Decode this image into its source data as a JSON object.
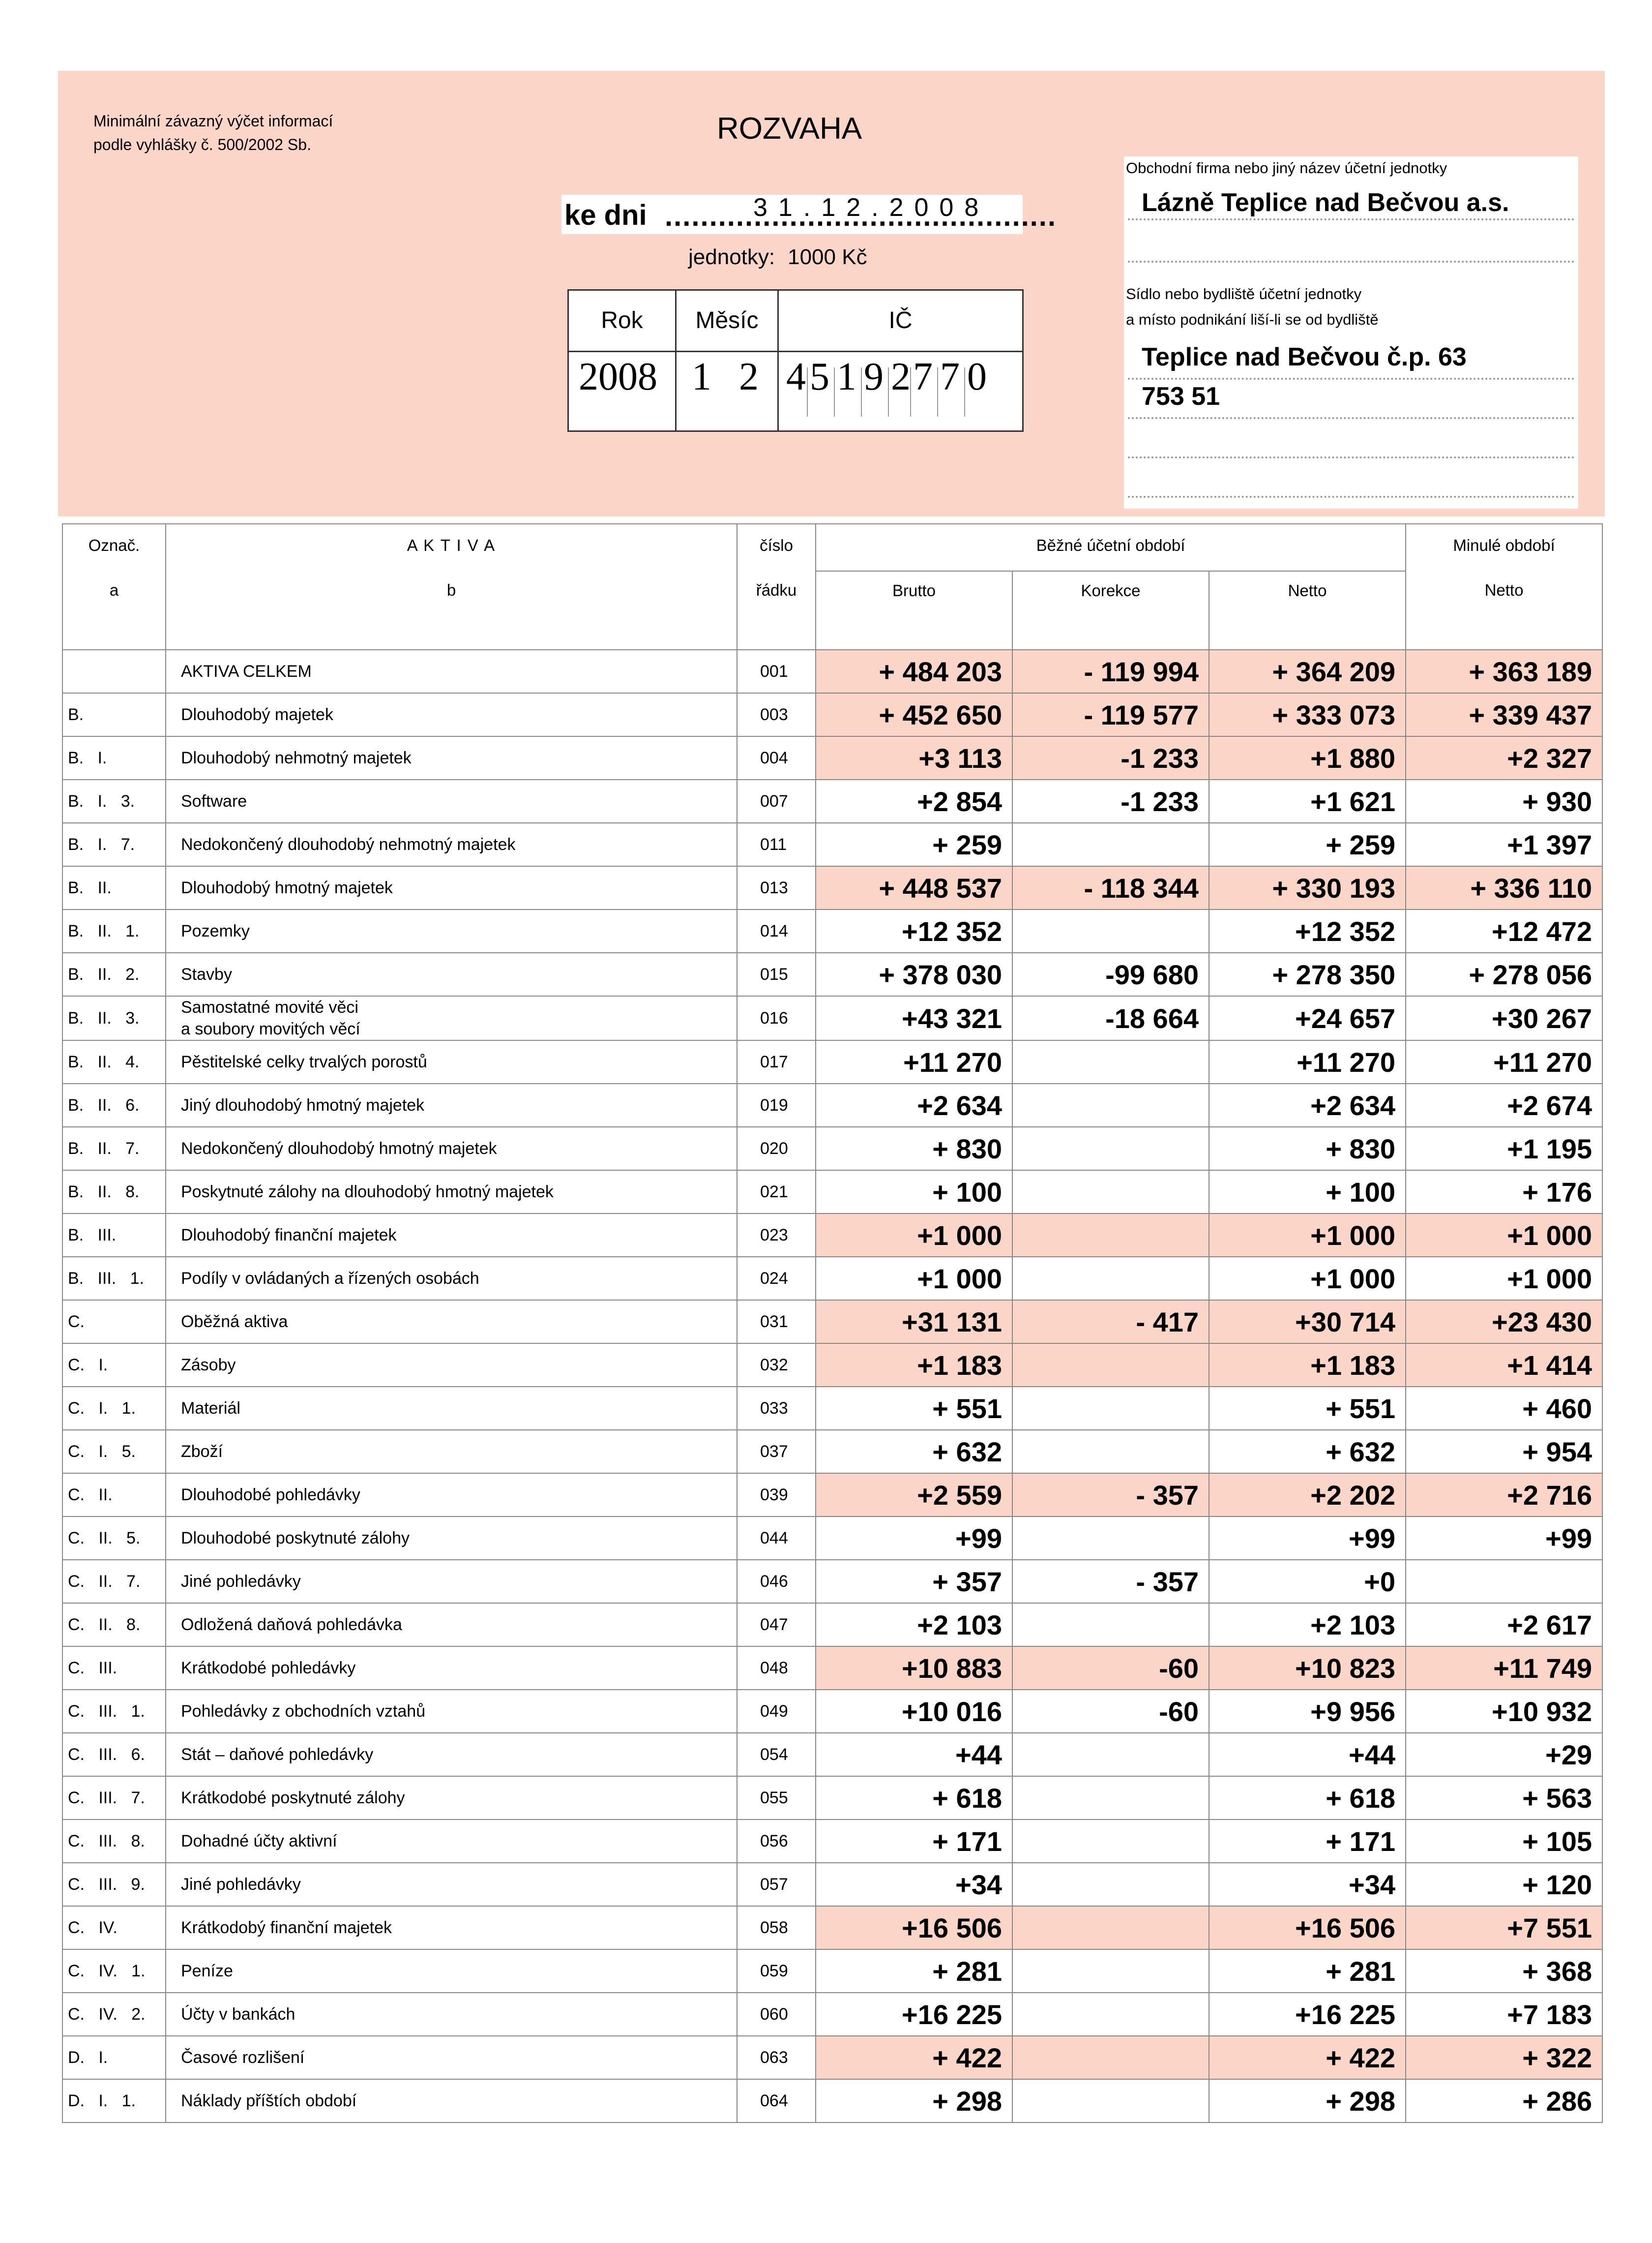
{
  "header": {
    "note_line1": "Minimální závazný výčet informací",
    "note_line2": "podle vyhlášky č. 500/2002 Sb.",
    "title": "ROZVAHA",
    "ke_dni_label": "ke dni",
    "date": "31.12.2008",
    "units_label": "jednotky:",
    "units_value": "1000 Kč",
    "col_rok": "Rok",
    "col_mesic": "Měsíc",
    "col_ic": "IČ",
    "rok": "2008",
    "mesic_digits": [
      "1",
      "2"
    ],
    "ic_digits": [
      "4",
      "5",
      "1",
      "9",
      "2",
      "7",
      "7",
      "0"
    ]
  },
  "firm": {
    "name_label": "Obchodní firma nebo jiný název účetní jednotky",
    "name": "Lázně Teplice nad Bečvou a.s.",
    "seat_label1": "Sídlo nebo bydliště účetní jednotky",
    "seat_label2": "a místo podnikání liší-li se od bydliště",
    "address1": "Teplice nad Bečvou č.p. 63",
    "address2": "753 51"
  },
  "table": {
    "h_oznac": "Označ.",
    "h_oznac_sub": "a",
    "h_aktiva": "A K T I V A",
    "h_aktiva_sub": "b",
    "h_cislo": "číslo",
    "h_radku": "řádku",
    "h_bezne": "Běžné účetní období",
    "h_minule": "Minulé období",
    "h_brutto": "Brutto",
    "h_korekce": "Korekce",
    "h_netto": "Netto",
    "h_netto_prev": "Netto",
    "rows": [
      {
        "mark": "",
        "name": "AKTIVA CELKEM",
        "code": "001",
        "brutto": "+ 484 203",
        "korekce": "- 119 994",
        "netto": "+ 364 209",
        "prev": "+ 363 189",
        "hl": true
      },
      {
        "mark": "B.",
        "name": "Dlouhodobý majetek",
        "code": "003",
        "brutto": "+ 452 650",
        "korekce": "- 119 577",
        "netto": "+ 333 073",
        "prev": "+ 339 437",
        "hl": true
      },
      {
        "mark": "B.   I.",
        "name": "Dlouhodobý nehmotný majetek",
        "code": "004",
        "brutto": "+3 113",
        "korekce": "-1 233",
        "netto": "+1 880",
        "prev": "+2 327",
        "hl": true
      },
      {
        "mark": "B.   I.   3.",
        "name": "Software",
        "code": "007",
        "brutto": "+2 854",
        "korekce": "-1 233",
        "netto": "+1 621",
        "prev": "+ 930",
        "hl": false
      },
      {
        "mark": "B.   I.   7.",
        "name": "Nedokončený dlouhodobý nehmotný majetek",
        "code": "011",
        "brutto": "+ 259",
        "korekce": "",
        "netto": "+ 259",
        "prev": "+1 397",
        "hl": false
      },
      {
        "mark": "B.   II.",
        "name": "Dlouhodobý hmotný majetek",
        "code": "013",
        "brutto": "+ 448 537",
        "korekce": "- 118 344",
        "netto": "+ 330 193",
        "prev": "+ 336 110",
        "hl": true
      },
      {
        "mark": "B.   II.   1.",
        "name": "Pozemky",
        "code": "014",
        "brutto": "+12 352",
        "korekce": "",
        "netto": "+12 352",
        "prev": "+12 472",
        "hl": false
      },
      {
        "mark": "B.   II.   2.",
        "name": "Stavby",
        "code": "015",
        "brutto": "+ 378 030",
        "korekce": "-99 680",
        "netto": "+ 278 350",
        "prev": "+ 278 056",
        "hl": false
      },
      {
        "mark": "B.   II.   3.",
        "name": "Samostatné movité věci\na soubory movitých věcí",
        "code": "016",
        "brutto": "+43 321",
        "korekce": "-18 664",
        "netto": "+24 657",
        "prev": "+30 267",
        "hl": false
      },
      {
        "mark": "B.   II.   4.",
        "name": "Pěstitelské celky trvalých porostů",
        "code": "017",
        "brutto": "+11 270",
        "korekce": "",
        "netto": "+11 270",
        "prev": "+11 270",
        "hl": false
      },
      {
        "mark": "B.   II.   6.",
        "name": "Jiný dlouhodobý hmotný majetek",
        "code": "019",
        "brutto": "+2 634",
        "korekce": "",
        "netto": "+2 634",
        "prev": "+2 674",
        "hl": false
      },
      {
        "mark": "B.   II.   7.",
        "name": "Nedokončený dlouhodobý hmotný majetek",
        "code": "020",
        "brutto": "+ 830",
        "korekce": "",
        "netto": "+ 830",
        "prev": "+1 195",
        "hl": false
      },
      {
        "mark": "B.   II.   8.",
        "name": "Poskytnuté zálohy na dlouhodobý hmotný majetek",
        "code": "021",
        "brutto": "+ 100",
        "korekce": "",
        "netto": "+ 100",
        "prev": "+ 176",
        "hl": false
      },
      {
        "mark": "B.   III.",
        "name": "Dlouhodobý finanční majetek",
        "code": "023",
        "brutto": "+1 000",
        "korekce": "",
        "netto": "+1 000",
        "prev": "+1 000",
        "hl": true
      },
      {
        "mark": "B.   III.   1.",
        "name": "Podíly v ovládaných a řízených osobách",
        "code": "024",
        "brutto": "+1 000",
        "korekce": "",
        "netto": "+1 000",
        "prev": "+1 000",
        "hl": false
      },
      {
        "mark": "C.",
        "name": "Oběžná aktiva",
        "code": "031",
        "brutto": "+31 131",
        "korekce": "- 417",
        "netto": "+30 714",
        "prev": "+23 430",
        "hl": true
      },
      {
        "mark": "C.   I.",
        "name": "Zásoby",
        "code": "032",
        "brutto": "+1 183",
        "korekce": "",
        "netto": "+1 183",
        "prev": "+1 414",
        "hl": true
      },
      {
        "mark": "C.   I.   1.",
        "name": "Materiál",
        "code": "033",
        "brutto": "+ 551",
        "korekce": "",
        "netto": "+ 551",
        "prev": "+ 460",
        "hl": false
      },
      {
        "mark": "C.   I.   5.",
        "name": "Zboží",
        "code": "037",
        "brutto": "+ 632",
        "korekce": "",
        "netto": "+ 632",
        "prev": "+ 954",
        "hl": false
      },
      {
        "mark": "C.   II.",
        "name": "Dlouhodobé pohledávky",
        "code": "039",
        "brutto": "+2 559",
        "korekce": "- 357",
        "netto": "+2 202",
        "prev": "+2 716",
        "hl": true
      },
      {
        "mark": "C.   II.   5.",
        "name": "Dlouhodobé poskytnuté zálohy",
        "code": "044",
        "brutto": "+99",
        "korekce": "",
        "netto": "+99",
        "prev": "+99",
        "hl": false
      },
      {
        "mark": "C.   II.   7.",
        "name": "Jiné pohledávky",
        "code": "046",
        "brutto": "+ 357",
        "korekce": "- 357",
        "netto": "+0",
        "prev": "",
        "hl": false
      },
      {
        "mark": "C.   II.   8.",
        "name": "Odložená daňová pohledávka",
        "code": "047",
        "brutto": "+2 103",
        "korekce": "",
        "netto": "+2 103",
        "prev": "+2 617",
        "hl": false
      },
      {
        "mark": "C.   III.",
        "name": "Krátkodobé pohledávky",
        "code": "048",
        "brutto": "+10 883",
        "korekce": "-60",
        "netto": "+10 823",
        "prev": "+11 749",
        "hl": true
      },
      {
        "mark": "C.   III.   1.",
        "name": "Pohledávky z obchodních vztahů",
        "code": "049",
        "brutto": "+10 016",
        "korekce": "-60",
        "netto": "+9 956",
        "prev": "+10 932",
        "hl": false
      },
      {
        "mark": "C.   III.   6.",
        "name": "Stát – daňové pohledávky",
        "code": "054",
        "brutto": "+44",
        "korekce": "",
        "netto": "+44",
        "prev": "+29",
        "hl": false
      },
      {
        "mark": "C.   III.   7.",
        "name": "Krátkodobé poskytnuté zálohy",
        "code": "055",
        "brutto": "+ 618",
        "korekce": "",
        "netto": "+ 618",
        "prev": "+ 563",
        "hl": false
      },
      {
        "mark": "C.   III.   8.",
        "name": "Dohadné účty aktivní",
        "code": "056",
        "brutto": "+ 171",
        "korekce": "",
        "netto": "+ 171",
        "prev": "+ 105",
        "hl": false
      },
      {
        "mark": "C.   III.   9.",
        "name": "Jiné pohledávky",
        "code": "057",
        "brutto": "+34",
        "korekce": "",
        "netto": "+34",
        "prev": "+ 120",
        "hl": false
      },
      {
        "mark": "C.   IV.",
        "name": "Krátkodobý finanční majetek",
        "code": "058",
        "brutto": "+16 506",
        "korekce": "",
        "netto": "+16 506",
        "prev": "+7 551",
        "hl": true
      },
      {
        "mark": "C.   IV.   1.",
        "name": "Peníze",
        "code": "059",
        "brutto": "+ 281",
        "korekce": "",
        "netto": "+ 281",
        "prev": "+ 368",
        "hl": false
      },
      {
        "mark": "C.   IV.   2.",
        "name": "Účty v bankách",
        "code": "060",
        "brutto": "+16 225",
        "korekce": "",
        "netto": "+16 225",
        "prev": "+7 183",
        "hl": false
      },
      {
        "mark": "D.   I.",
        "name": "Časové rozlišení",
        "code": "063",
        "brutto": "+ 422",
        "korekce": "",
        "netto": "+ 422",
        "prev": "+ 322",
        "hl": true
      },
      {
        "mark": "D.   I.   1.",
        "name": "Náklady příštích období",
        "code": "064",
        "brutto": "+ 298",
        "korekce": "",
        "netto": "+ 298",
        "prev": "+ 286",
        "hl": false
      }
    ]
  }
}
